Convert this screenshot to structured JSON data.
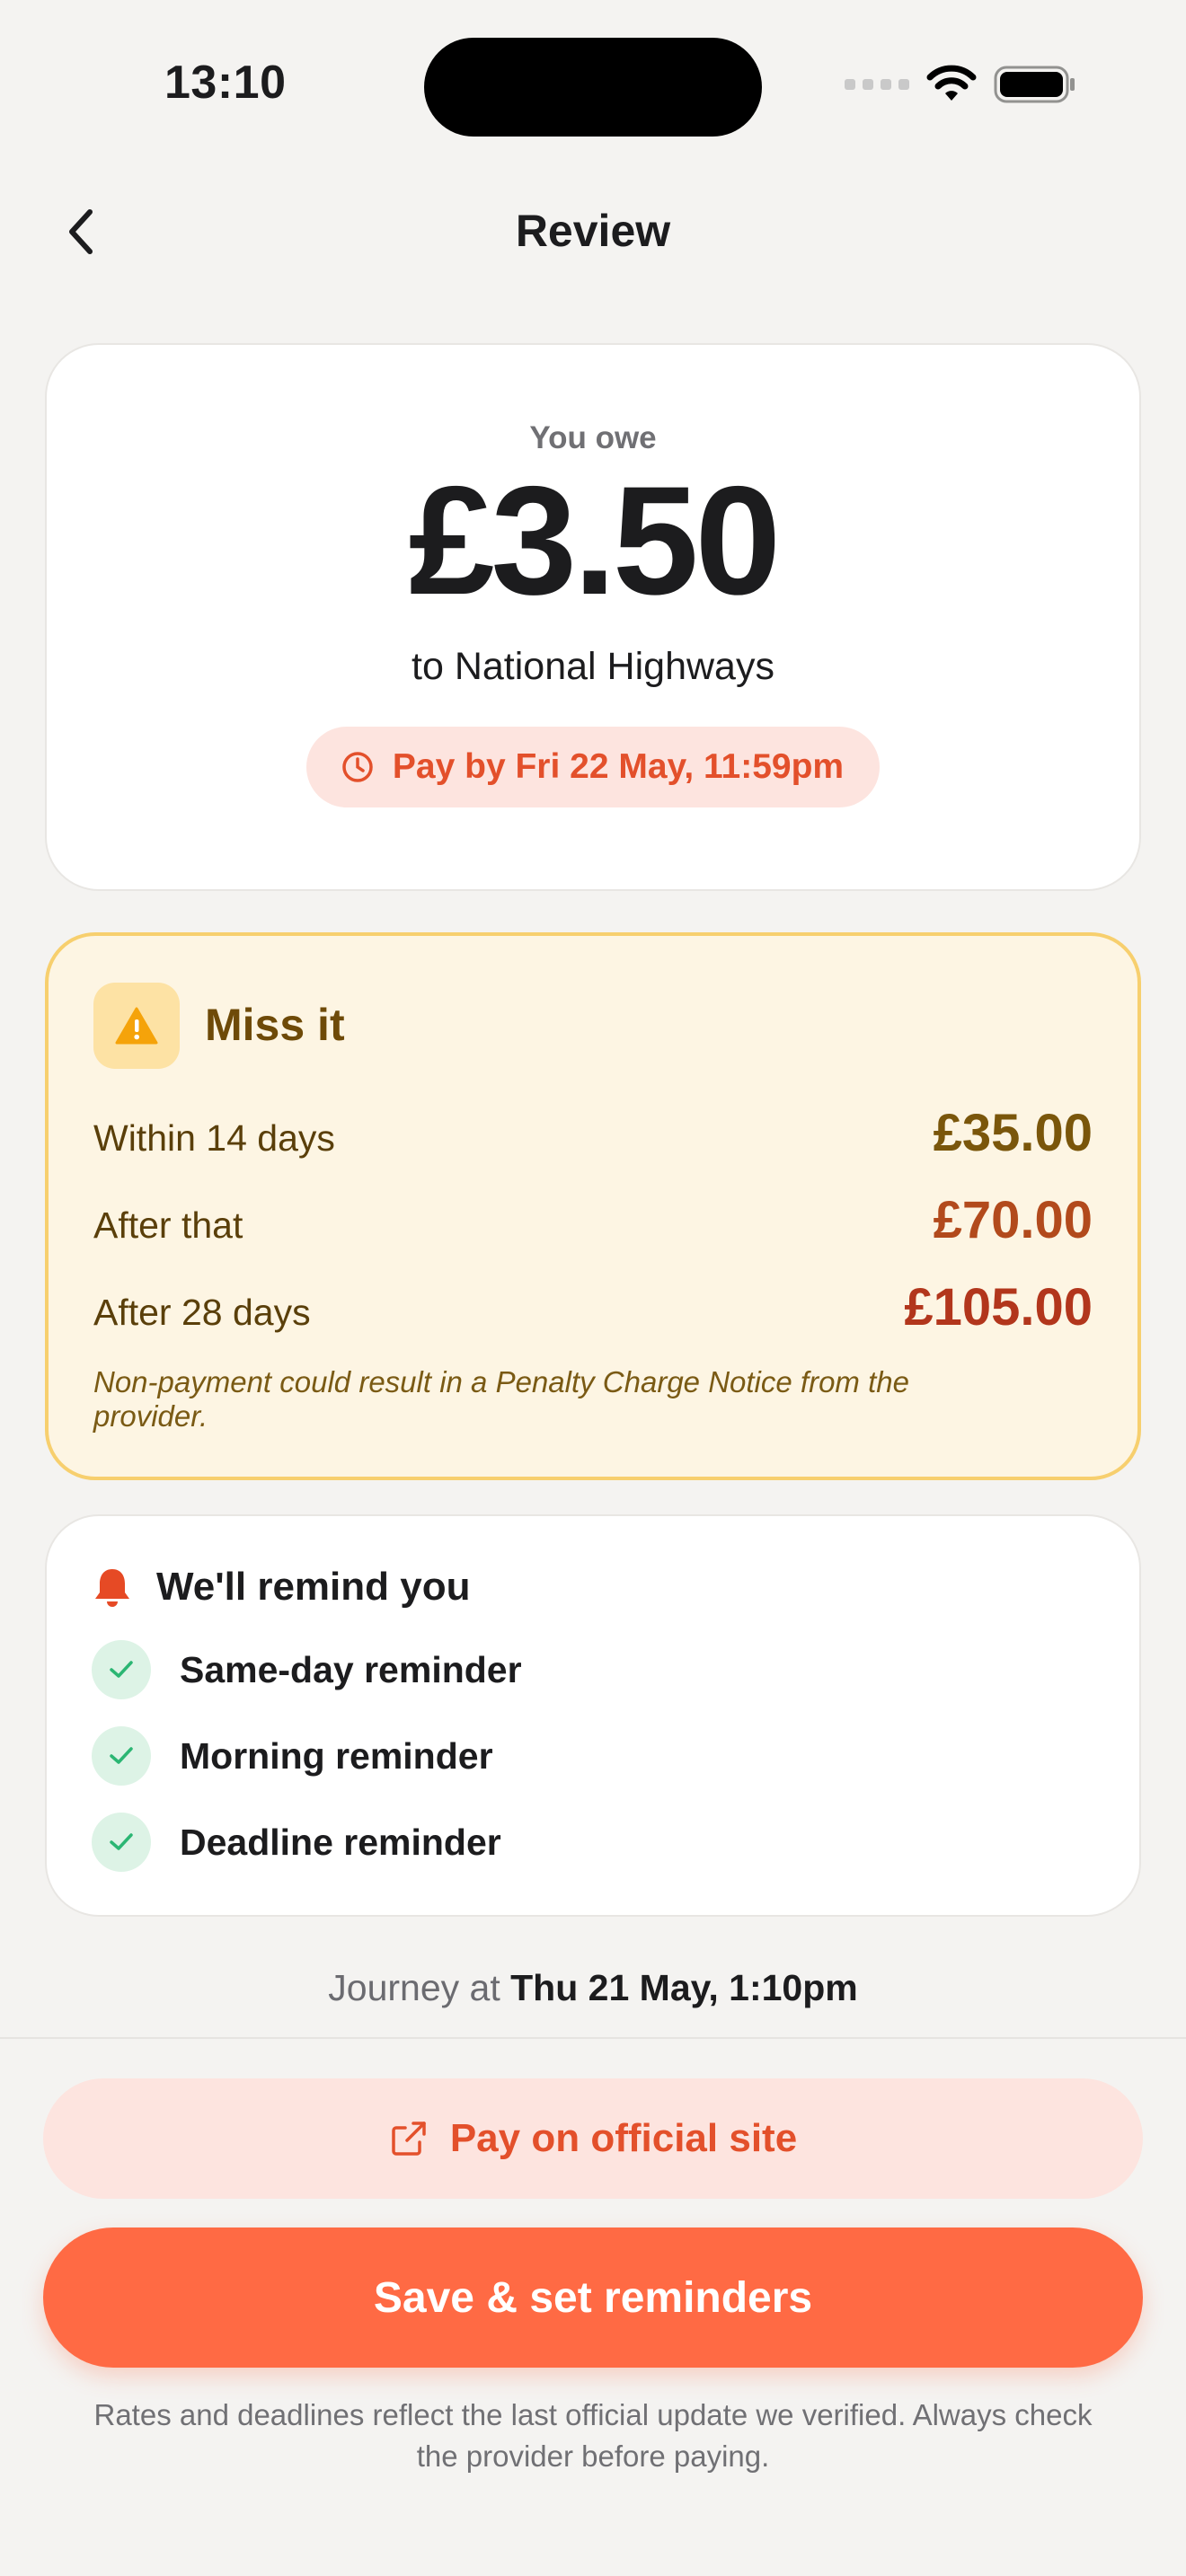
{
  "status_bar": {
    "time": "13:10"
  },
  "nav": {
    "title": "Review"
  },
  "amount_card": {
    "label": "You owe",
    "amount": "£3.50",
    "recipient": "to National Highways",
    "deadline": "Pay by Fri 22 May, 11:59pm"
  },
  "warning": {
    "title": "Miss it",
    "rows": [
      {
        "label": "Within 14 days",
        "value": "£35.00"
      },
      {
        "label": "After that",
        "value": "£70.00"
      },
      {
        "label": "After 28 days",
        "value": "£105.00"
      }
    ],
    "note": "Non-payment could result in a Penalty Charge Notice from the provider."
  },
  "reminders": {
    "title": "We'll remind you",
    "items": [
      "Same-day reminder",
      "Morning reminder",
      "Deadline reminder"
    ]
  },
  "journey": {
    "prefix": "Journey at",
    "datetime": "Thu 21 May, 1:10pm"
  },
  "actions": {
    "secondary_label": "Pay on official site",
    "primary_label": "Save & set reminders"
  },
  "disclaimer": "Rates and deadlines reflect the last official update we verified. Always check the provider before paying.",
  "colors": {
    "accent": "#ff6a44",
    "accent_text": "#e3502b",
    "warning_bg": "#fdf5e3",
    "warning_border": "#f7cf6e",
    "success": "#2bb673"
  }
}
